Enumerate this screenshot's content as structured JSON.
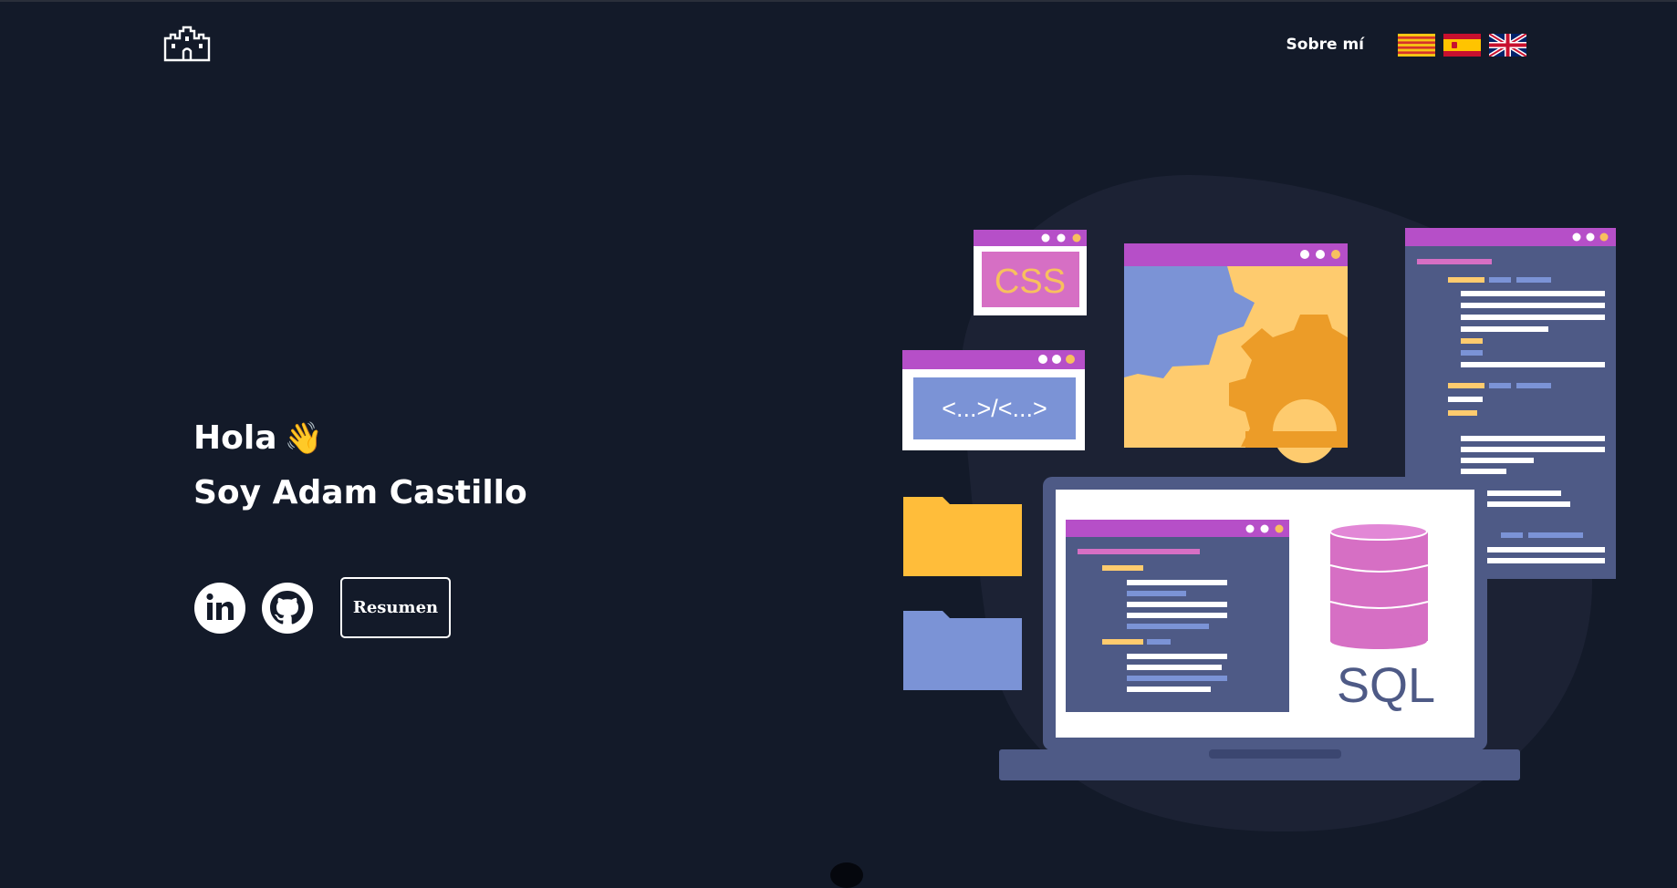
{
  "nav": {
    "logo_icon": "castle-icon",
    "about_label": "Sobre mí",
    "flags": [
      "catalan-flag-icon",
      "spanish-flag-icon",
      "uk-flag-icon"
    ]
  },
  "hero": {
    "greeting": "Hola",
    "wave_emoji": "👋",
    "name_line": "Soy Adam Castillo"
  },
  "actions": {
    "linkedin_icon": "linkedin-icon",
    "github_icon": "github-icon",
    "resume_label": "Resumen"
  },
  "illustration": {
    "css_label": "CSS",
    "html_label": "<...>/<...>",
    "sql_label": "SQL"
  },
  "colors": {
    "background": "#131a29",
    "window_bar": "#b64fc8",
    "panel": "#4e5a86",
    "yellow": "#ffc83c",
    "blue": "#7b93d6",
    "pink": "#d66fc4"
  }
}
